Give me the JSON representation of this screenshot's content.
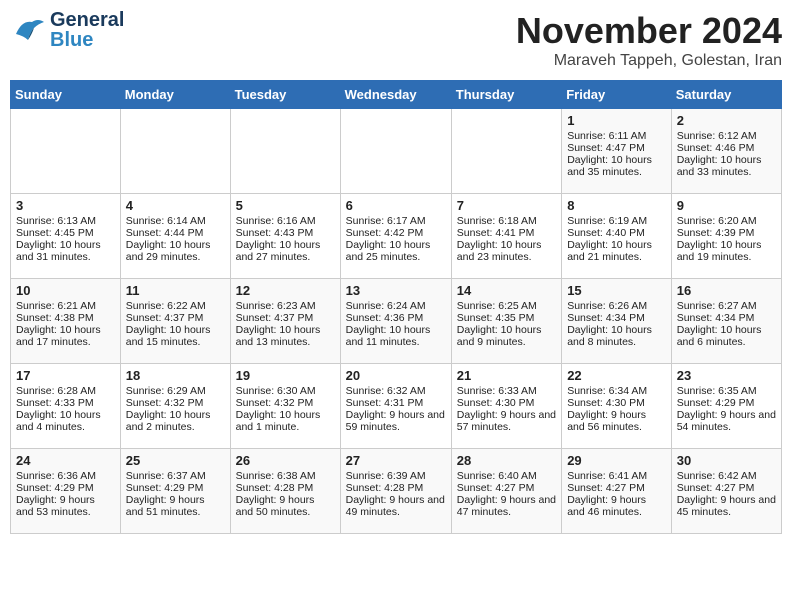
{
  "header": {
    "logo_gen": "General",
    "logo_blue": "Blue",
    "month": "November 2024",
    "location": "Maraveh Tappeh, Golestan, Iran"
  },
  "days_of_week": [
    "Sunday",
    "Monday",
    "Tuesday",
    "Wednesday",
    "Thursday",
    "Friday",
    "Saturday"
  ],
  "weeks": [
    [
      {
        "day": "",
        "info": ""
      },
      {
        "day": "",
        "info": ""
      },
      {
        "day": "",
        "info": ""
      },
      {
        "day": "",
        "info": ""
      },
      {
        "day": "",
        "info": ""
      },
      {
        "day": "1",
        "info": "Sunrise: 6:11 AM\nSunset: 4:47 PM\nDaylight: 10 hours and 35 minutes."
      },
      {
        "day": "2",
        "info": "Sunrise: 6:12 AM\nSunset: 4:46 PM\nDaylight: 10 hours and 33 minutes."
      }
    ],
    [
      {
        "day": "3",
        "info": "Sunrise: 6:13 AM\nSunset: 4:45 PM\nDaylight: 10 hours and 31 minutes."
      },
      {
        "day": "4",
        "info": "Sunrise: 6:14 AM\nSunset: 4:44 PM\nDaylight: 10 hours and 29 minutes."
      },
      {
        "day": "5",
        "info": "Sunrise: 6:16 AM\nSunset: 4:43 PM\nDaylight: 10 hours and 27 minutes."
      },
      {
        "day": "6",
        "info": "Sunrise: 6:17 AM\nSunset: 4:42 PM\nDaylight: 10 hours and 25 minutes."
      },
      {
        "day": "7",
        "info": "Sunrise: 6:18 AM\nSunset: 4:41 PM\nDaylight: 10 hours and 23 minutes."
      },
      {
        "day": "8",
        "info": "Sunrise: 6:19 AM\nSunset: 4:40 PM\nDaylight: 10 hours and 21 minutes."
      },
      {
        "day": "9",
        "info": "Sunrise: 6:20 AM\nSunset: 4:39 PM\nDaylight: 10 hours and 19 minutes."
      }
    ],
    [
      {
        "day": "10",
        "info": "Sunrise: 6:21 AM\nSunset: 4:38 PM\nDaylight: 10 hours and 17 minutes."
      },
      {
        "day": "11",
        "info": "Sunrise: 6:22 AM\nSunset: 4:37 PM\nDaylight: 10 hours and 15 minutes."
      },
      {
        "day": "12",
        "info": "Sunrise: 6:23 AM\nSunset: 4:37 PM\nDaylight: 10 hours and 13 minutes."
      },
      {
        "day": "13",
        "info": "Sunrise: 6:24 AM\nSunset: 4:36 PM\nDaylight: 10 hours and 11 minutes."
      },
      {
        "day": "14",
        "info": "Sunrise: 6:25 AM\nSunset: 4:35 PM\nDaylight: 10 hours and 9 minutes."
      },
      {
        "day": "15",
        "info": "Sunrise: 6:26 AM\nSunset: 4:34 PM\nDaylight: 10 hours and 8 minutes."
      },
      {
        "day": "16",
        "info": "Sunrise: 6:27 AM\nSunset: 4:34 PM\nDaylight: 10 hours and 6 minutes."
      }
    ],
    [
      {
        "day": "17",
        "info": "Sunrise: 6:28 AM\nSunset: 4:33 PM\nDaylight: 10 hours and 4 minutes."
      },
      {
        "day": "18",
        "info": "Sunrise: 6:29 AM\nSunset: 4:32 PM\nDaylight: 10 hours and 2 minutes."
      },
      {
        "day": "19",
        "info": "Sunrise: 6:30 AM\nSunset: 4:32 PM\nDaylight: 10 hours and 1 minute."
      },
      {
        "day": "20",
        "info": "Sunrise: 6:32 AM\nSunset: 4:31 PM\nDaylight: 9 hours and 59 minutes."
      },
      {
        "day": "21",
        "info": "Sunrise: 6:33 AM\nSunset: 4:30 PM\nDaylight: 9 hours and 57 minutes."
      },
      {
        "day": "22",
        "info": "Sunrise: 6:34 AM\nSunset: 4:30 PM\nDaylight: 9 hours and 56 minutes."
      },
      {
        "day": "23",
        "info": "Sunrise: 6:35 AM\nSunset: 4:29 PM\nDaylight: 9 hours and 54 minutes."
      }
    ],
    [
      {
        "day": "24",
        "info": "Sunrise: 6:36 AM\nSunset: 4:29 PM\nDaylight: 9 hours and 53 minutes."
      },
      {
        "day": "25",
        "info": "Sunrise: 6:37 AM\nSunset: 4:29 PM\nDaylight: 9 hours and 51 minutes."
      },
      {
        "day": "26",
        "info": "Sunrise: 6:38 AM\nSunset: 4:28 PM\nDaylight: 9 hours and 50 minutes."
      },
      {
        "day": "27",
        "info": "Sunrise: 6:39 AM\nSunset: 4:28 PM\nDaylight: 9 hours and 49 minutes."
      },
      {
        "day": "28",
        "info": "Sunrise: 6:40 AM\nSunset: 4:27 PM\nDaylight: 9 hours and 47 minutes."
      },
      {
        "day": "29",
        "info": "Sunrise: 6:41 AM\nSunset: 4:27 PM\nDaylight: 9 hours and 46 minutes."
      },
      {
        "day": "30",
        "info": "Sunrise: 6:42 AM\nSunset: 4:27 PM\nDaylight: 9 hours and 45 minutes."
      }
    ]
  ]
}
